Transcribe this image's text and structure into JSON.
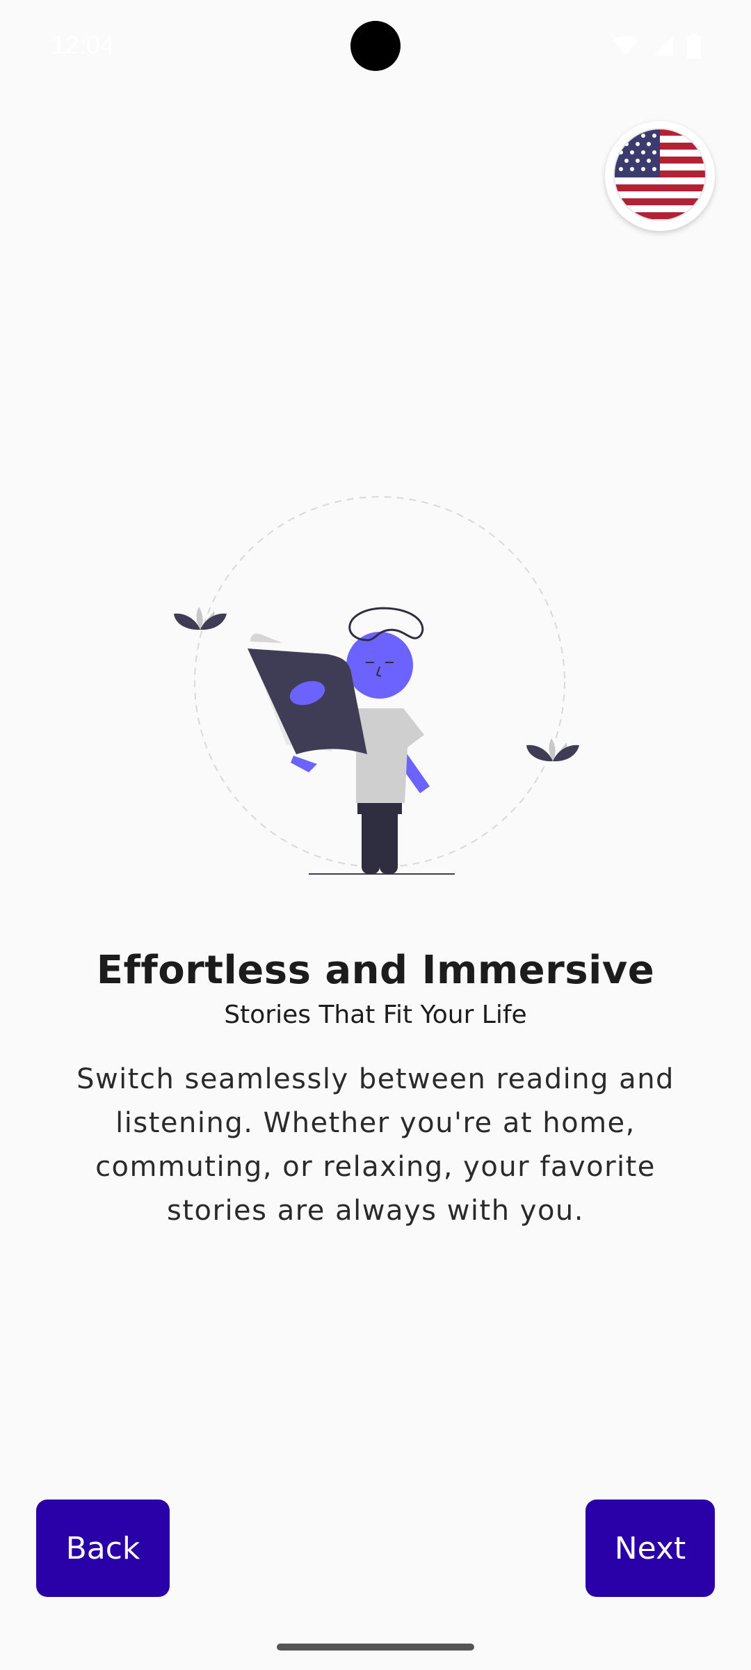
{
  "status_bar": {
    "time": "12:04",
    "icons": [
      "wifi-icon",
      "signal-icon",
      "battery-icon"
    ]
  },
  "language_selector": {
    "icon": "us-flag-icon"
  },
  "onboarding": {
    "title": "Effortless and Immersive",
    "subtitle": "Stories That Fit Your Life",
    "description_lines": [
      "Switch seamlessly between reading and",
      "listening. Whether you're at home,",
      "commuting, or relaxing, your favorite",
      "stories are always with you."
    ]
  },
  "navigation": {
    "back_label": "Back",
    "next_label": "Next"
  },
  "colors": {
    "accent": "#2a00a8",
    "illustration_primary": "#6c63ff",
    "illustration_dark": "#3f3d56",
    "background": "#fafafa"
  }
}
